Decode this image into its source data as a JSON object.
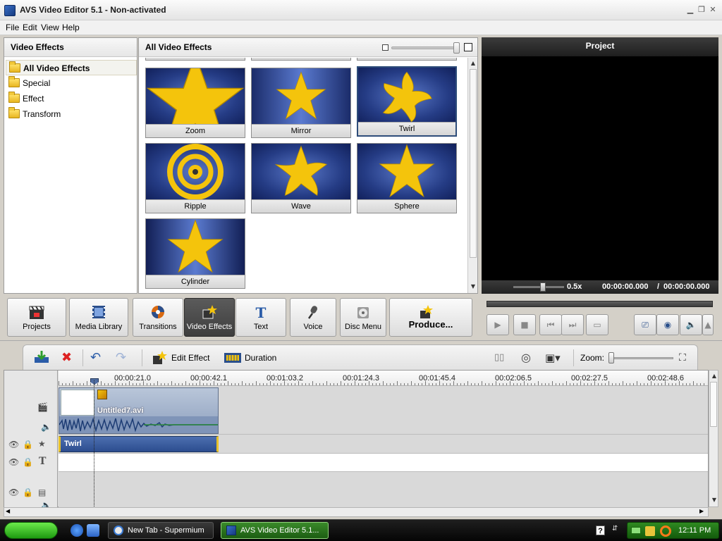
{
  "window": {
    "title": "AVS Video Editor 5.1 - Non-activated"
  },
  "menu": {
    "items": [
      "File",
      "Edit",
      "View",
      "Help"
    ]
  },
  "left_panel": {
    "header": "Video Effects",
    "items": [
      "All Video Effects",
      "Special",
      "Effect",
      "Transform"
    ]
  },
  "effects_panel": {
    "header": "All Video Effects",
    "effects": [
      "Zoom",
      "Mirror",
      "Twirl",
      "Ripple",
      "Wave",
      "Sphere",
      "Cylinder"
    ]
  },
  "preview": {
    "header": "Project",
    "speed": "0.5x",
    "time_current": "00:00:00.000",
    "time_separator": "/",
    "time_total": "00:00:00.000"
  },
  "toolbar": {
    "projects": "Projects",
    "media_library": "Media Library",
    "transitions": "Transitions",
    "video_effects": "Video Effects",
    "text": "Text",
    "voice": "Voice",
    "disc_menu": "Disc Menu",
    "produce": "Produce..."
  },
  "timeline_toolbar": {
    "edit_effect": "Edit Effect",
    "duration": "Duration",
    "zoom_label": "Zoom:"
  },
  "timeline": {
    "ruler": [
      "00:00:21.0",
      "00:00:42.1",
      "00:01:03.2",
      "00:01:24.3",
      "00:01:45.4",
      "00:02:06.5",
      "00:02:27.5",
      "00:02:48.6"
    ],
    "video_clip": "Untitled7.avi",
    "effect_clip": "Twirl"
  },
  "taskbar": {
    "task1": "New Tab - Supermium",
    "task2": "AVS Video Editor 5.1...",
    "clock": "12:11 PM"
  },
  "colors": {
    "accent_blue": "#2c4d8f",
    "star_yellow": "#f4c40c",
    "preview_bg": "#000000"
  }
}
